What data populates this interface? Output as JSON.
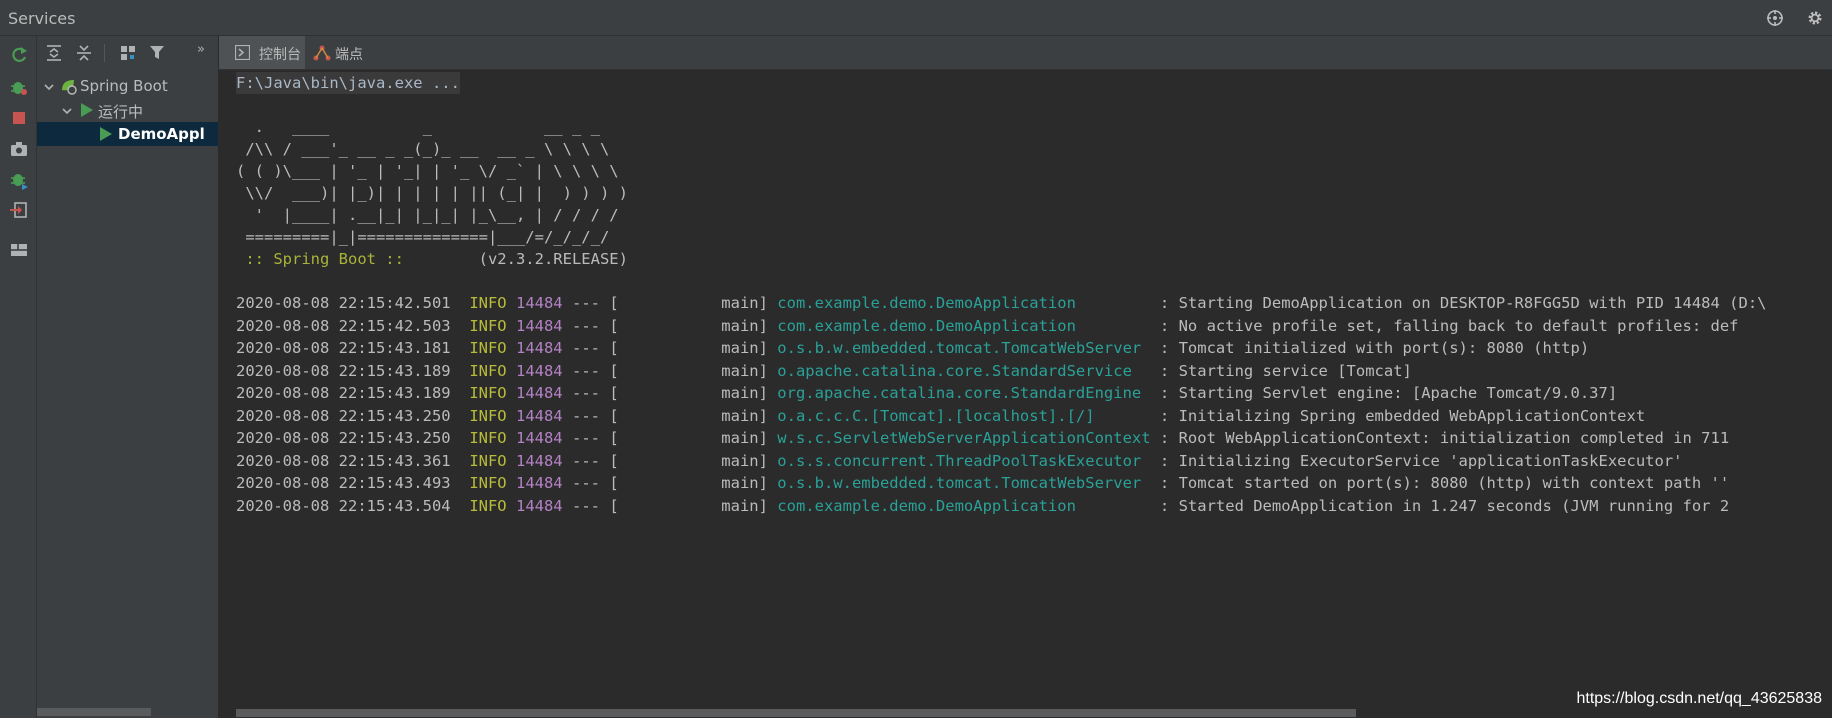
{
  "window": {
    "title": "Services"
  },
  "tree": {
    "nodes": [
      {
        "label": "Spring Boot",
        "icon": "spring-boot-icon"
      },
      {
        "label": "运行中",
        "icon": "run-icon"
      },
      {
        "label": "DemoAppl",
        "icon": "run-icon"
      }
    ]
  },
  "tabs": [
    {
      "label": "控制台",
      "icon": "console-icon"
    },
    {
      "label": "端点",
      "icon": "endpoints-icon"
    }
  ],
  "console": {
    "command": "F:\\Java\\bin\\java.exe ...",
    "banner": [
      "  .   ____          _            __ _ _",
      " /\\\\ / ___'_ __ _ _(_)_ __  __ _ \\ \\ \\ \\",
      "( ( )\\___ | '_ | '_| | '_ \\/ _` | \\ \\ \\ \\",
      " \\\\/  ___)| |_)| | | | | || (_| |  ) ) ) )",
      "  '  |____| .__|_| |_|_| |_\\__, | / / / /",
      " =========|_|==============|___/=/_/_/_/"
    ],
    "spring_label": " :: Spring Boot :: ",
    "spring_version": "       (v2.3.2.RELEASE)",
    "logs": [
      {
        "ts": "2020-08-08 22:15:42.501",
        "level": "INFO",
        "pid": "14484",
        "sep": " --- [",
        "thread": "           main] ",
        "logger": "com.example.demo.DemoApplication        ",
        "message": " : Starting DemoApplication on DESKTOP-R8FGG5D with PID 14484 (D:\\"
      },
      {
        "ts": "2020-08-08 22:15:42.503",
        "level": "INFO",
        "pid": "14484",
        "sep": " --- [",
        "thread": "           main] ",
        "logger": "com.example.demo.DemoApplication        ",
        "message": " : No active profile set, falling back to default profiles: def"
      },
      {
        "ts": "2020-08-08 22:15:43.181",
        "level": "INFO",
        "pid": "14484",
        "sep": " --- [",
        "thread": "           main] ",
        "logger": "o.s.b.w.embedded.tomcat.TomcatWebServer ",
        "message": " : Tomcat initialized with port(s): 8080 (http)"
      },
      {
        "ts": "2020-08-08 22:15:43.189",
        "level": "INFO",
        "pid": "14484",
        "sep": " --- [",
        "thread": "           main] ",
        "logger": "o.apache.catalina.core.StandardService  ",
        "message": " : Starting service [Tomcat]"
      },
      {
        "ts": "2020-08-08 22:15:43.189",
        "level": "INFO",
        "pid": "14484",
        "sep": " --- [",
        "thread": "           main] ",
        "logger": "org.apache.catalina.core.StandardEngine ",
        "message": " : Starting Servlet engine: [Apache Tomcat/9.0.37]"
      },
      {
        "ts": "2020-08-08 22:15:43.250",
        "level": "INFO",
        "pid": "14484",
        "sep": " --- [",
        "thread": "           main] ",
        "logger": "o.a.c.c.C.[Tomcat].[localhost].[/]      ",
        "message": " : Initializing Spring embedded WebApplicationContext"
      },
      {
        "ts": "2020-08-08 22:15:43.250",
        "level": "INFO",
        "pid": "14484",
        "sep": " --- [",
        "thread": "           main] ",
        "logger": "w.s.c.ServletWebServerApplicationContext",
        "message": " : Root WebApplicationContext: initialization completed in 711"
      },
      {
        "ts": "2020-08-08 22:15:43.361",
        "level": "INFO",
        "pid": "14484",
        "sep": " --- [",
        "thread": "           main] ",
        "logger": "o.s.s.concurrent.ThreadPoolTaskExecutor ",
        "message": " : Initializing ExecutorService 'applicationTaskExecutor'"
      },
      {
        "ts": "2020-08-08 22:15:43.493",
        "level": "INFO",
        "pid": "14484",
        "sep": " --- [",
        "thread": "           main] ",
        "logger": "o.s.b.w.embedded.tomcat.TomcatWebServer ",
        "message": " : Tomcat started on port(s): 8080 (http) with context path ''"
      },
      {
        "ts": "2020-08-08 22:15:43.504",
        "level": "INFO",
        "pid": "14484",
        "sep": " --- [",
        "thread": "           main] ",
        "logger": "com.example.demo.DemoApplication        ",
        "message": " : Started DemoApplication in 1.247 seconds (JVM running for 2"
      }
    ]
  },
  "watermark": "https://blog.csdn.net/qq_43625838",
  "colors": {
    "background": "#2b2b2b",
    "panel": "#3c3f41",
    "selection": "#0d293e",
    "info": "#b8bc3a",
    "pid": "#b382c4",
    "logger": "#2aa198"
  }
}
